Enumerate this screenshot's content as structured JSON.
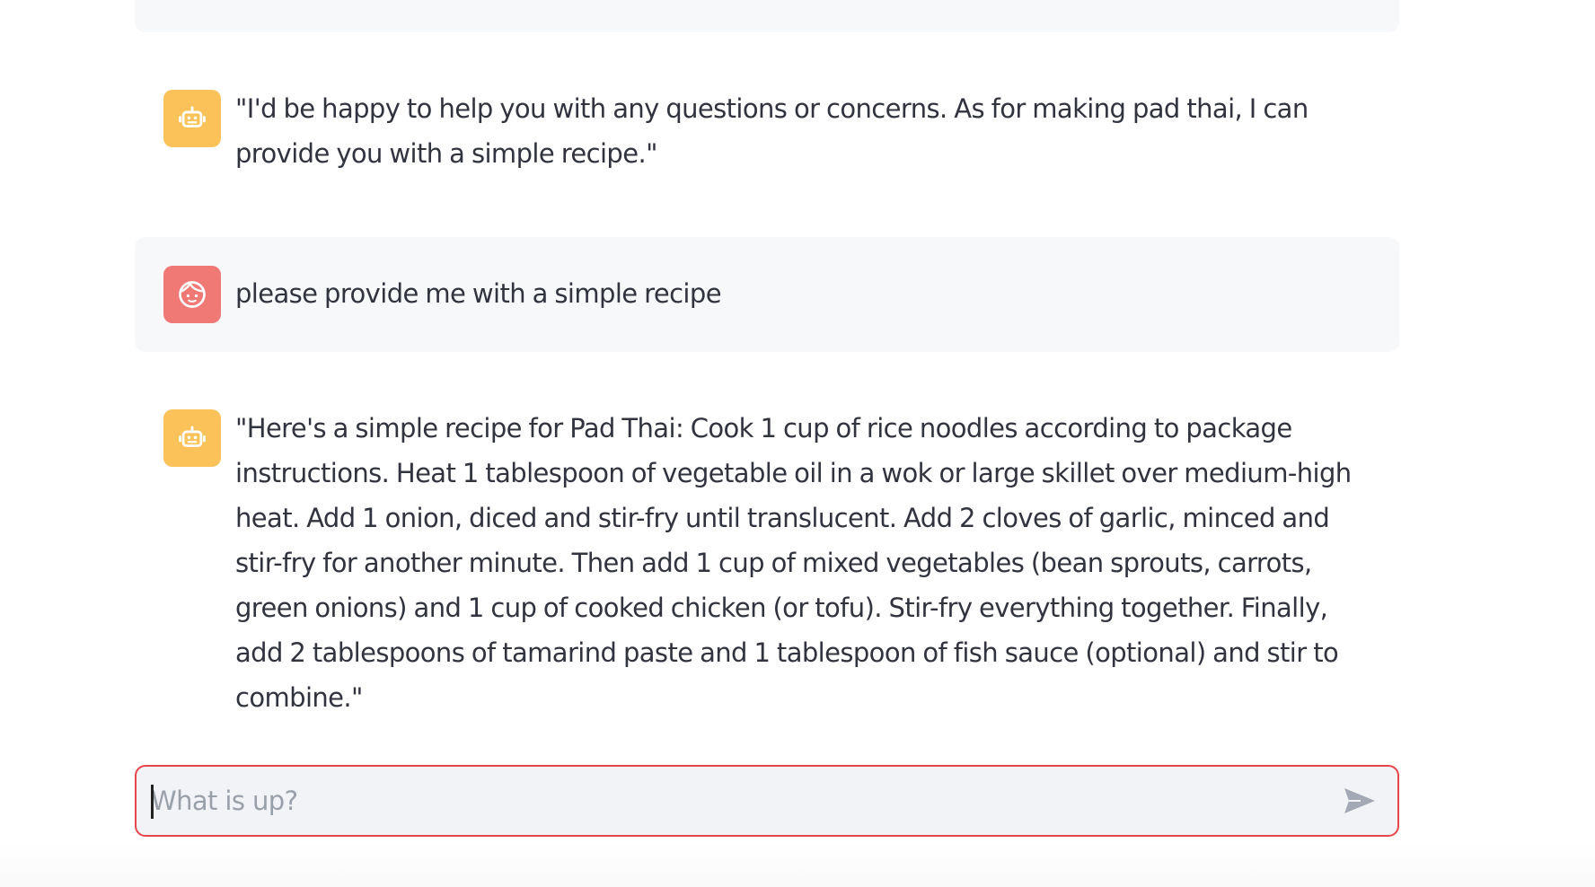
{
  "messages": [
    {
      "role": "user",
      "text": ""
    },
    {
      "role": "assistant",
      "text": "\"I'd be happy to help you with any questions or concerns. As for making pad thai, I can provide you with a simple recipe.\""
    },
    {
      "role": "user",
      "text": "please provide me with a simple recipe"
    },
    {
      "role": "assistant",
      "text": "\"Here's a simple recipe for Pad Thai: Cook 1 cup of rice noodles according to package instructions. Heat 1 tablespoon of vegetable oil in a wok or large skillet over medium-high heat. Add 1 onion, diced and stir-fry until translucent. Add 2 cloves of garlic, minced and stir-fry for another minute. Then add 1 cup of mixed vegetables (bean sprouts, carrots, green onions) and 1 cup of cooked chicken (or tofu). Stir-fry everything together. Finally, add 2 tablespoons of tamarind paste and 1 tablespoon of fish sauce (optional) and stir to combine.\""
    }
  ],
  "chat_input": {
    "placeholder": "What is up?",
    "value": "",
    "border_color": "#e8454a"
  },
  "icons": {
    "assistant_avatar": "robot-icon",
    "user_avatar": "face-icon",
    "send": "send-icon"
  },
  "colors": {
    "assistant_avatar_bg": "#fbc25a",
    "user_avatar_bg": "#f07875",
    "user_message_bg": "#f7f8fa",
    "text": "#31333f"
  }
}
